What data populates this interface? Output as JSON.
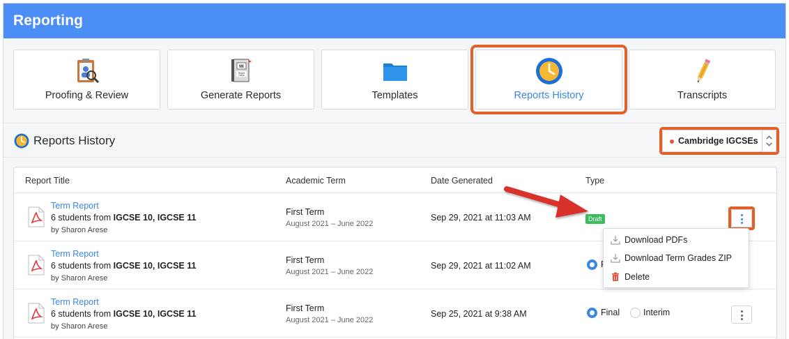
{
  "app": {
    "title": "Reporting"
  },
  "tiles": [
    {
      "label": "Proofing & Review",
      "icon": "clipboard-magnifier-icon"
    },
    {
      "label": "Generate Reports",
      "icon": "report-cards-book-icon",
      "book_text": "Report Cards"
    },
    {
      "label": "Templates",
      "icon": "folder-icon"
    },
    {
      "label": "Reports History",
      "icon": "clock-icon",
      "active": true
    },
    {
      "label": "Transcripts",
      "icon": "pencil-icon"
    }
  ],
  "section": {
    "title": "Reports History",
    "selector": {
      "value": "Cambridge IGCSEs",
      "dot_color": "#e8513d"
    }
  },
  "table": {
    "columns": [
      "Report Title",
      "Academic Term",
      "Date Generated",
      "Type"
    ],
    "rows": [
      {
        "title": "Term Report",
        "desc_prefix": "6 students from ",
        "desc_bold": "IGCSE 10, IGCSE 11",
        "author": "by Sharon Arese",
        "term": "First Term",
        "range": "August 2021 – June 2022",
        "date": "Sep 29, 2021 at 11:03 AM",
        "type_badge": "Draft"
      },
      {
        "title": "Term Report",
        "desc_prefix": "6 students from ",
        "desc_bold": "IGCSE 10, IGCSE 11",
        "author": "by Sharon Arese",
        "term": "First Term",
        "range": "August 2021 – June 2022",
        "date": "Sep 29, 2021 at 11:02 AM",
        "final_label": "F"
      },
      {
        "title": "Term Report",
        "desc_prefix": "6 students from ",
        "desc_bold": "IGCSE 10, IGCSE 11",
        "author": "by Sharon Arese",
        "term": "First Term",
        "range": "August 2021 – June 2022",
        "date": "Sep 25, 2021 at 9:38 AM",
        "final_label": "Final",
        "interim_label": "Interim"
      }
    ]
  },
  "menu": {
    "items": [
      {
        "label": "Download PDFs",
        "icon": "download-icon"
      },
      {
        "label": "Download Term Grades ZIP",
        "icon": "download-icon"
      },
      {
        "label": "Delete",
        "icon": "trash-icon"
      }
    ]
  },
  "colors": {
    "header": "#4b8ff6",
    "accent": "#3a87e3",
    "highlight": "#e0622a",
    "draft": "#3dbb61",
    "delete_icon": "#e8513d"
  }
}
